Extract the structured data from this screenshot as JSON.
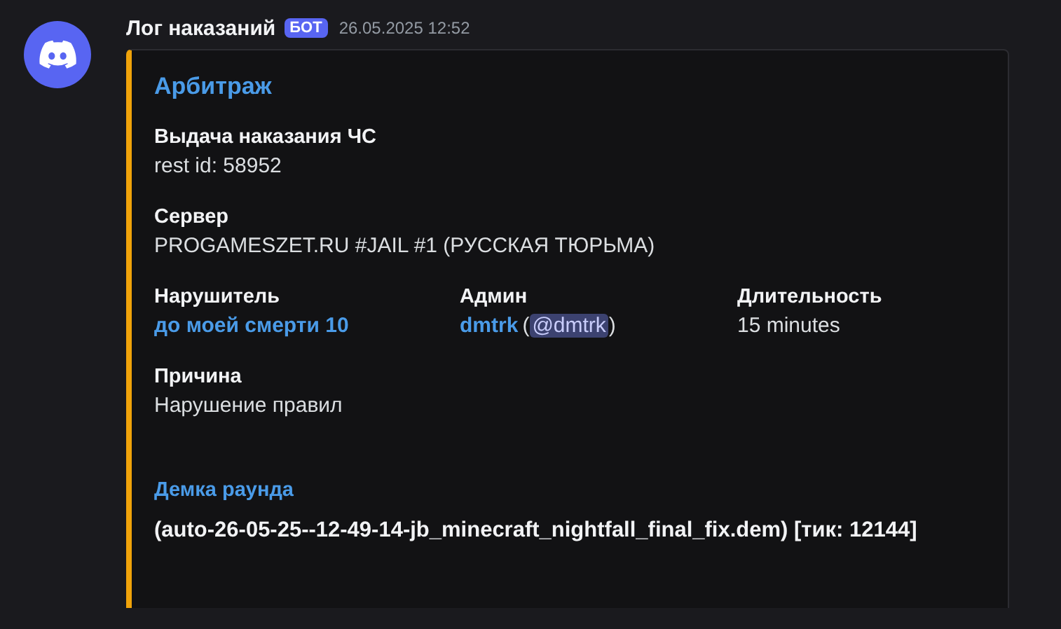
{
  "message": {
    "author": "Лог наказаний",
    "badge": "БОТ",
    "timestamp": "26.05.2025 12:52"
  },
  "embed": {
    "color": "#f0a30a",
    "title": "Арбитраж",
    "fields": [
      {
        "kind": "field",
        "inline": false,
        "name": "Выдача наказания ЧС",
        "value": [
          {
            "kind": "plain",
            "text": "rest id: 58952"
          }
        ]
      },
      {
        "kind": "field",
        "inline": false,
        "name": "Сервер",
        "value": [
          {
            "kind": "plain",
            "text": "PROGAMESZET.RU #JAIL #1 (РУССКАЯ ТЮРЬМА)"
          }
        ]
      },
      {
        "kind": "field",
        "inline": true,
        "name": "Нарушитель",
        "value": [
          {
            "kind": "link",
            "text": "до моей смерти 10"
          }
        ]
      },
      {
        "kind": "field",
        "inline": true,
        "name": "Админ",
        "value": [
          {
            "kind": "link",
            "text": "dmtrk"
          },
          {
            "kind": "plain",
            "text": "("
          },
          {
            "kind": "mention",
            "text": "@dmtrk"
          },
          {
            "kind": "plain",
            "text": ")"
          }
        ]
      },
      {
        "kind": "field",
        "inline": true,
        "name": "Длительность",
        "value": [
          {
            "kind": "plain",
            "text": "15 minutes"
          }
        ]
      },
      {
        "kind": "field",
        "inline": false,
        "name": "Причина",
        "value": [
          {
            "kind": "plain",
            "text": "Нарушение правил"
          }
        ]
      },
      {
        "kind": "link",
        "inline": false,
        "name": "Демка раунда",
        "value": [
          {
            "kind": "bold",
            "text": "(auto-26-05-25--12-49-14-jb_minecraft_nightfall_final_fix.dem) [тик: 12144]"
          }
        ]
      }
    ]
  }
}
